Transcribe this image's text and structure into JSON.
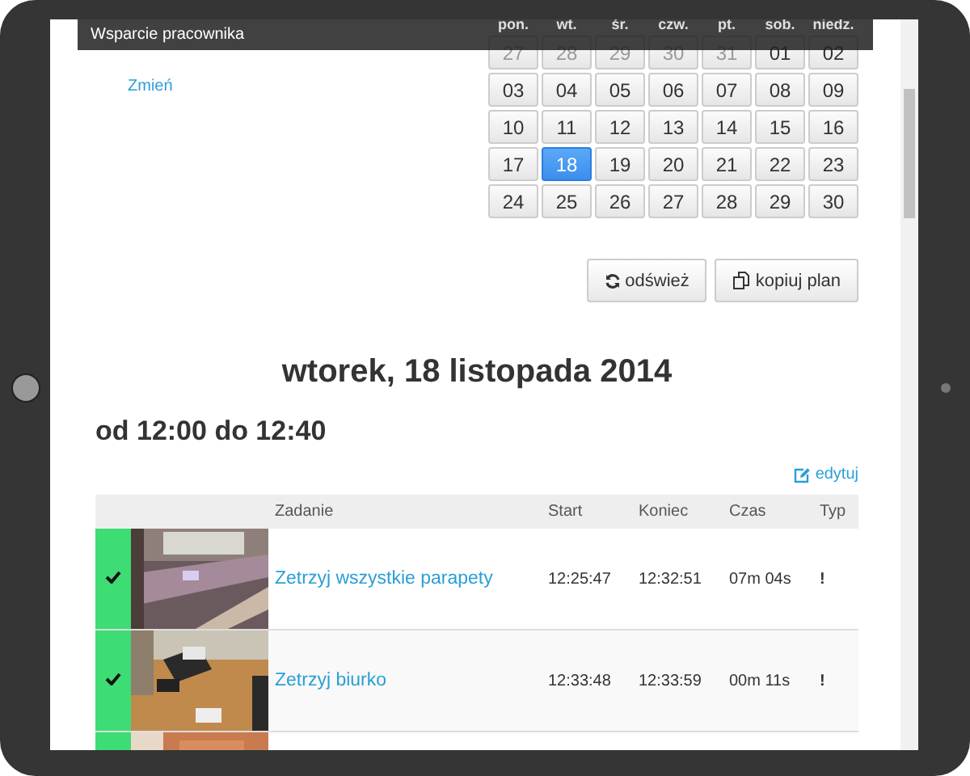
{
  "top_bar": {
    "title": "Wsparcie pracownika"
  },
  "change_link": "Zmień",
  "calendar": {
    "weekdays": [
      "pon.",
      "wt.",
      "śr.",
      "czw.",
      "pt.",
      "sob.",
      "niedz."
    ],
    "weeks": [
      [
        {
          "label": "27",
          "muted": true,
          "selected": false
        },
        {
          "label": "28",
          "muted": true,
          "selected": false
        },
        {
          "label": "29",
          "muted": true,
          "selected": false
        },
        {
          "label": "30",
          "muted": true,
          "selected": false
        },
        {
          "label": "31",
          "muted": true,
          "selected": false
        },
        {
          "label": "01",
          "muted": false,
          "selected": false
        },
        {
          "label": "02",
          "muted": false,
          "selected": false
        }
      ],
      [
        {
          "label": "03",
          "muted": false,
          "selected": false
        },
        {
          "label": "04",
          "muted": false,
          "selected": false
        },
        {
          "label": "05",
          "muted": false,
          "selected": false
        },
        {
          "label": "06",
          "muted": false,
          "selected": false
        },
        {
          "label": "07",
          "muted": false,
          "selected": false
        },
        {
          "label": "08",
          "muted": false,
          "selected": false
        },
        {
          "label": "09",
          "muted": false,
          "selected": false
        }
      ],
      [
        {
          "label": "10",
          "muted": false,
          "selected": false
        },
        {
          "label": "11",
          "muted": false,
          "selected": false
        },
        {
          "label": "12",
          "muted": false,
          "selected": false
        },
        {
          "label": "13",
          "muted": false,
          "selected": false
        },
        {
          "label": "14",
          "muted": false,
          "selected": false
        },
        {
          "label": "15",
          "muted": false,
          "selected": false
        },
        {
          "label": "16",
          "muted": false,
          "selected": false
        }
      ],
      [
        {
          "label": "17",
          "muted": false,
          "selected": false
        },
        {
          "label": "18",
          "muted": false,
          "selected": true
        },
        {
          "label": "19",
          "muted": false,
          "selected": false
        },
        {
          "label": "20",
          "muted": false,
          "selected": false
        },
        {
          "label": "21",
          "muted": false,
          "selected": false
        },
        {
          "label": "22",
          "muted": false,
          "selected": false
        },
        {
          "label": "23",
          "muted": false,
          "selected": false
        }
      ],
      [
        {
          "label": "24",
          "muted": false,
          "selected": false
        },
        {
          "label": "25",
          "muted": false,
          "selected": false
        },
        {
          "label": "26",
          "muted": false,
          "selected": false
        },
        {
          "label": "27",
          "muted": false,
          "selected": false
        },
        {
          "label": "28",
          "muted": false,
          "selected": false
        },
        {
          "label": "29",
          "muted": false,
          "selected": false
        },
        {
          "label": "30",
          "muted": false,
          "selected": false
        }
      ]
    ]
  },
  "buttons": [
    {
      "kind": "refresh",
      "label": "odśwież"
    },
    {
      "kind": "copy",
      "label": "kopiuj plan"
    }
  ],
  "date_heading": "wtorek, 18 listopada 2014",
  "time_range": "od 12:00 do 12:40",
  "edit_link": "edytuj",
  "table": {
    "columns": [
      "Zadanie",
      "Start",
      "Koniec",
      "Czas",
      "Typ"
    ],
    "rows": [
      {
        "done": true,
        "task": "Zetrzyj wszystkie parapety",
        "start": "12:25:47",
        "end": "12:32:51",
        "duration": "07m 04s",
        "type": "!"
      },
      {
        "done": true,
        "task": "Zetrzyj biurko",
        "start": "12:33:48",
        "end": "12:33:59",
        "duration": "00m 11s",
        "type": "!"
      },
      {
        "done": true
      }
    ]
  }
}
